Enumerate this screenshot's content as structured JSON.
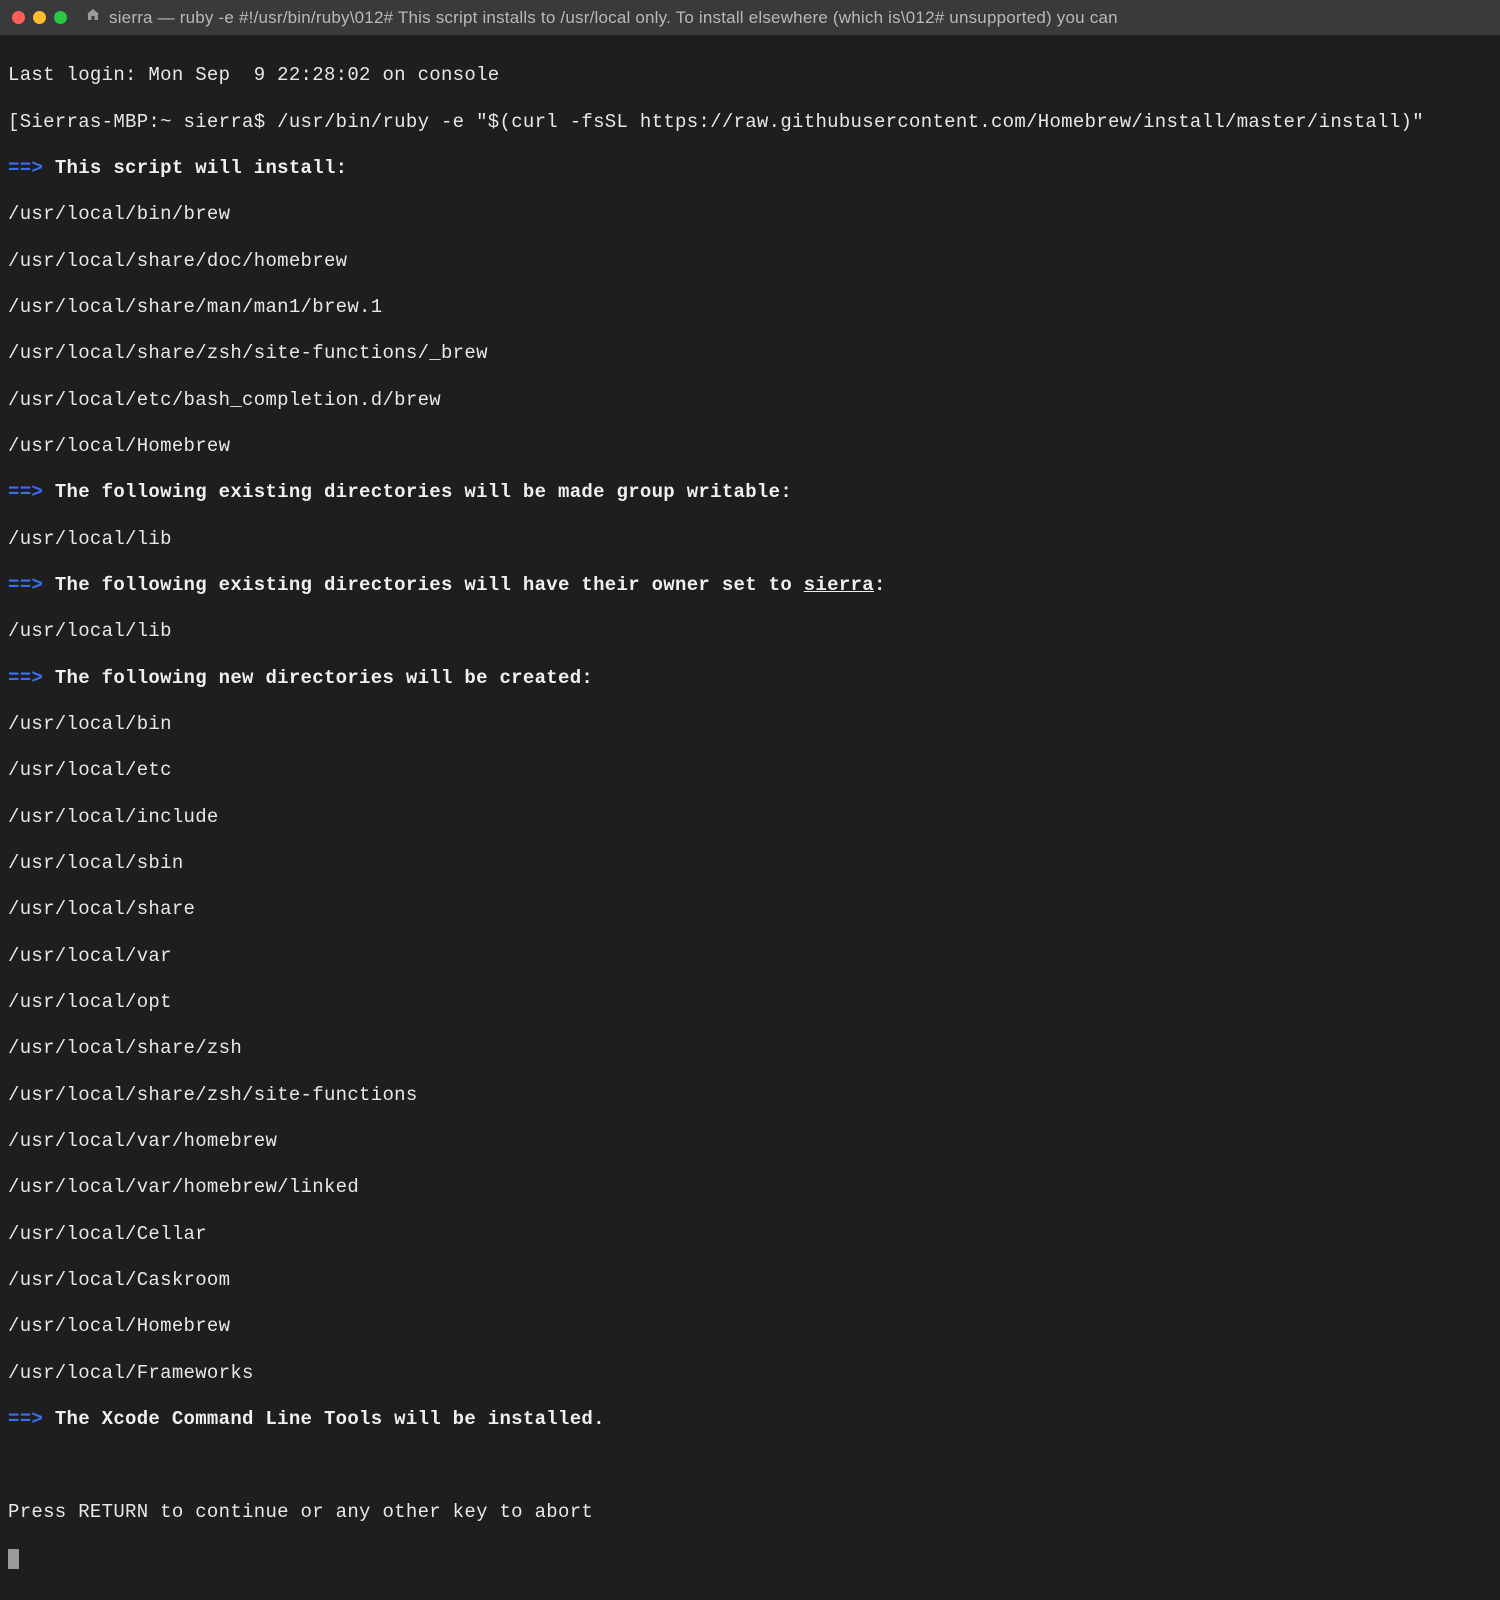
{
  "window": {
    "title": "sierra — ruby -e #!/usr/bin/ruby\\012# This script installs to /usr/local only. To install elsewhere (which is\\012# unsupported) you can"
  },
  "colors": {
    "arrow": "#3a6df0",
    "bg": "#1e1e1e",
    "fg": "#e8e8e8"
  },
  "last_login": "Last login: Mon Sep  9 22:28:02 on console",
  "prompt": {
    "host": "[Sierras-MBP:~ sierra$ ",
    "command": "/usr/bin/ruby -e \"$(curl -fsSL https://raw.githubusercontent.com/Homebrew/install/master/install)\""
  },
  "arr": "==>",
  "sections": {
    "install_hdr": "This script will install:",
    "install_paths": [
      "/usr/local/bin/brew",
      "/usr/local/share/doc/homebrew",
      "/usr/local/share/man/man1/brew.1",
      "/usr/local/share/zsh/site-functions/_brew",
      "/usr/local/etc/bash_completion.d/brew",
      "/usr/local/Homebrew"
    ],
    "writable_hdr": "The following existing directories will be made group writable:",
    "writable_paths": [
      "/usr/local/lib"
    ],
    "owner_hdr_pre": "The following existing directories will have their owner set to ",
    "owner_user": "sierra",
    "owner_hdr_post": ":",
    "owner_paths": [
      "/usr/local/lib"
    ],
    "new_hdr": "The following new directories will be created:",
    "new_paths": [
      "/usr/local/bin",
      "/usr/local/etc",
      "/usr/local/include",
      "/usr/local/sbin",
      "/usr/local/share",
      "/usr/local/var",
      "/usr/local/opt",
      "/usr/local/share/zsh",
      "/usr/local/share/zsh/site-functions",
      "/usr/local/var/homebrew",
      "/usr/local/var/homebrew/linked",
      "/usr/local/Cellar",
      "/usr/local/Caskroom",
      "/usr/local/Homebrew",
      "/usr/local/Frameworks"
    ],
    "xcode_hdr": "The Xcode Command Line Tools will be installed."
  },
  "press_return": "Press RETURN to continue or any other key to abort"
}
